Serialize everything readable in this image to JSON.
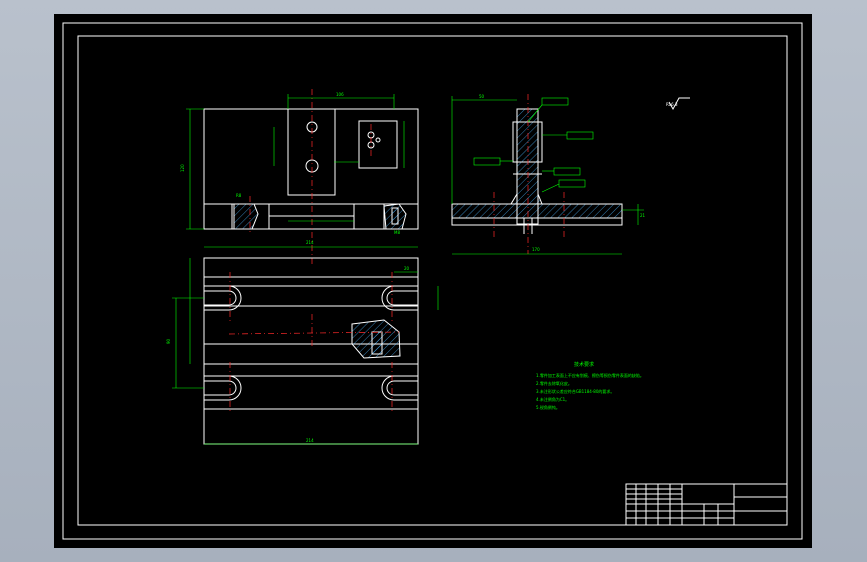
{
  "drawing": {
    "tech_requirements_title": "技术要求",
    "tech_requirements_lines": [
      "1.零件加工表面上不应有划痕、擦伤等损伤零件表面的缺陷。",
      "2.零件去除氧化皮。",
      "3.未注形状公差应符合GB1184-80的要求。",
      "4.未注倒角为C1。",
      "5.锐角倒钝。"
    ],
    "roughness_mark": "Ra6.3"
  },
  "colors": {
    "background": "#000000",
    "linework": "#ffffff",
    "dimensions": "#00ff00",
    "centerlines": "#ff2a2a",
    "title_block": "#ffffff"
  }
}
